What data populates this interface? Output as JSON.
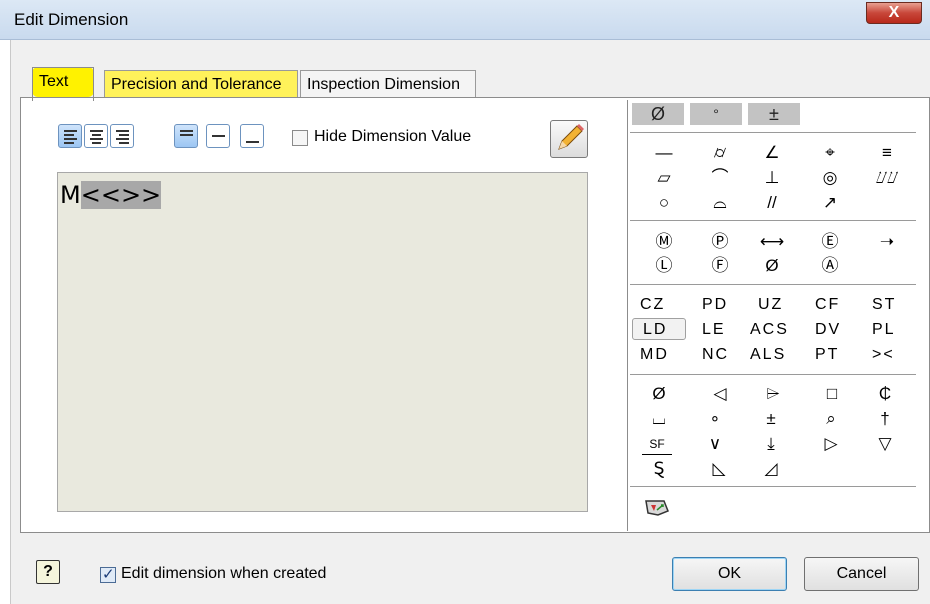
{
  "window": {
    "title": "Edit Dimension",
    "close_glyph": "X"
  },
  "tabs": [
    {
      "label": "Text"
    },
    {
      "label": "Precision and Tolerance"
    },
    {
      "label": "Inspection Dimension"
    }
  ],
  "toolbar": {
    "hide_value_label": "Hide Dimension Value",
    "hide_value_checked": false,
    "icons": [
      "align-left-icon",
      "align-center-icon",
      "align-right-icon",
      "align-top-icon",
      "align-middle-icon",
      "align-bottom-icon",
      "pencil-edit-icon"
    ]
  },
  "editor": {
    "prefix": "M",
    "token": "<<>>"
  },
  "symbols": {
    "top_buttons": [
      "Ø",
      "°",
      "±"
    ],
    "gdt_row1": [
      "⌭",
      "⌯",
      "∠",
      "⌖",
      "≡"
    ],
    "gdt_row2": [
      "▱",
      "⌒",
      "⊥",
      "◎",
      "⌰⌰"
    ],
    "gdt_row3": [
      "○",
      "⌓",
      "//",
      "↗"
    ],
    "modifiers_row1": [
      "Ⓜ",
      "Ⓟ",
      "⟷",
      "Ⓔ",
      "➝"
    ],
    "modifiers_row2": [
      "Ⓛ",
      "Ⓕ",
      "Ø",
      "Ⓐ"
    ],
    "codes": [
      [
        "CZ",
        "PD",
        "UZ",
        "CF",
        "ST"
      ],
      [
        "LD",
        "LE",
        "ACS",
        "DV",
        "PL"
      ],
      [
        "MD",
        "NC",
        "ALS",
        "PT",
        "><"
      ]
    ],
    "misc_row1": [
      "Ø",
      "◁",
      "⌲",
      "□",
      "₵"
    ],
    "misc_row2": [
      "⌴",
      "∘",
      "±",
      "⌕",
      "†"
    ],
    "misc_row3": [
      "SF",
      "∨",
      "⤓",
      "▷",
      "▽"
    ],
    "misc_row4": [
      "Ȿ",
      "◺",
      "◿"
    ]
  },
  "footer": {
    "help_glyph": "?",
    "edit_when_created_label": "Edit dimension when created",
    "edit_when_created_checked": true,
    "ok_label": "OK",
    "cancel_label": "Cancel"
  },
  "colors": {
    "highlight": "#fff200",
    "editor_bg": "#e9e9de",
    "selection": "#a8a8a8"
  }
}
